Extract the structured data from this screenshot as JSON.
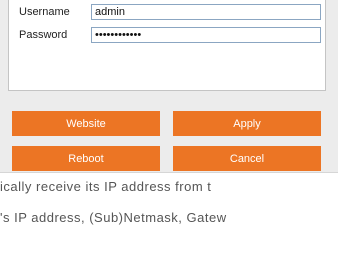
{
  "login": {
    "username_label": "Username",
    "username_value": "admin",
    "password_label": "Password",
    "password_value": "admin1234567"
  },
  "buttons": {
    "website": "Website",
    "apply": "Apply",
    "reboot": "Reboot",
    "cancel": "Cancel"
  },
  "text": {
    "line1": "ically receive its IP address from t",
    "line2": "'s IP address, (Sub)Netmask, Gatew"
  },
  "colors": {
    "accent": "#ec7524",
    "panel": "#ececec",
    "field_border": "#8ba6c2"
  }
}
